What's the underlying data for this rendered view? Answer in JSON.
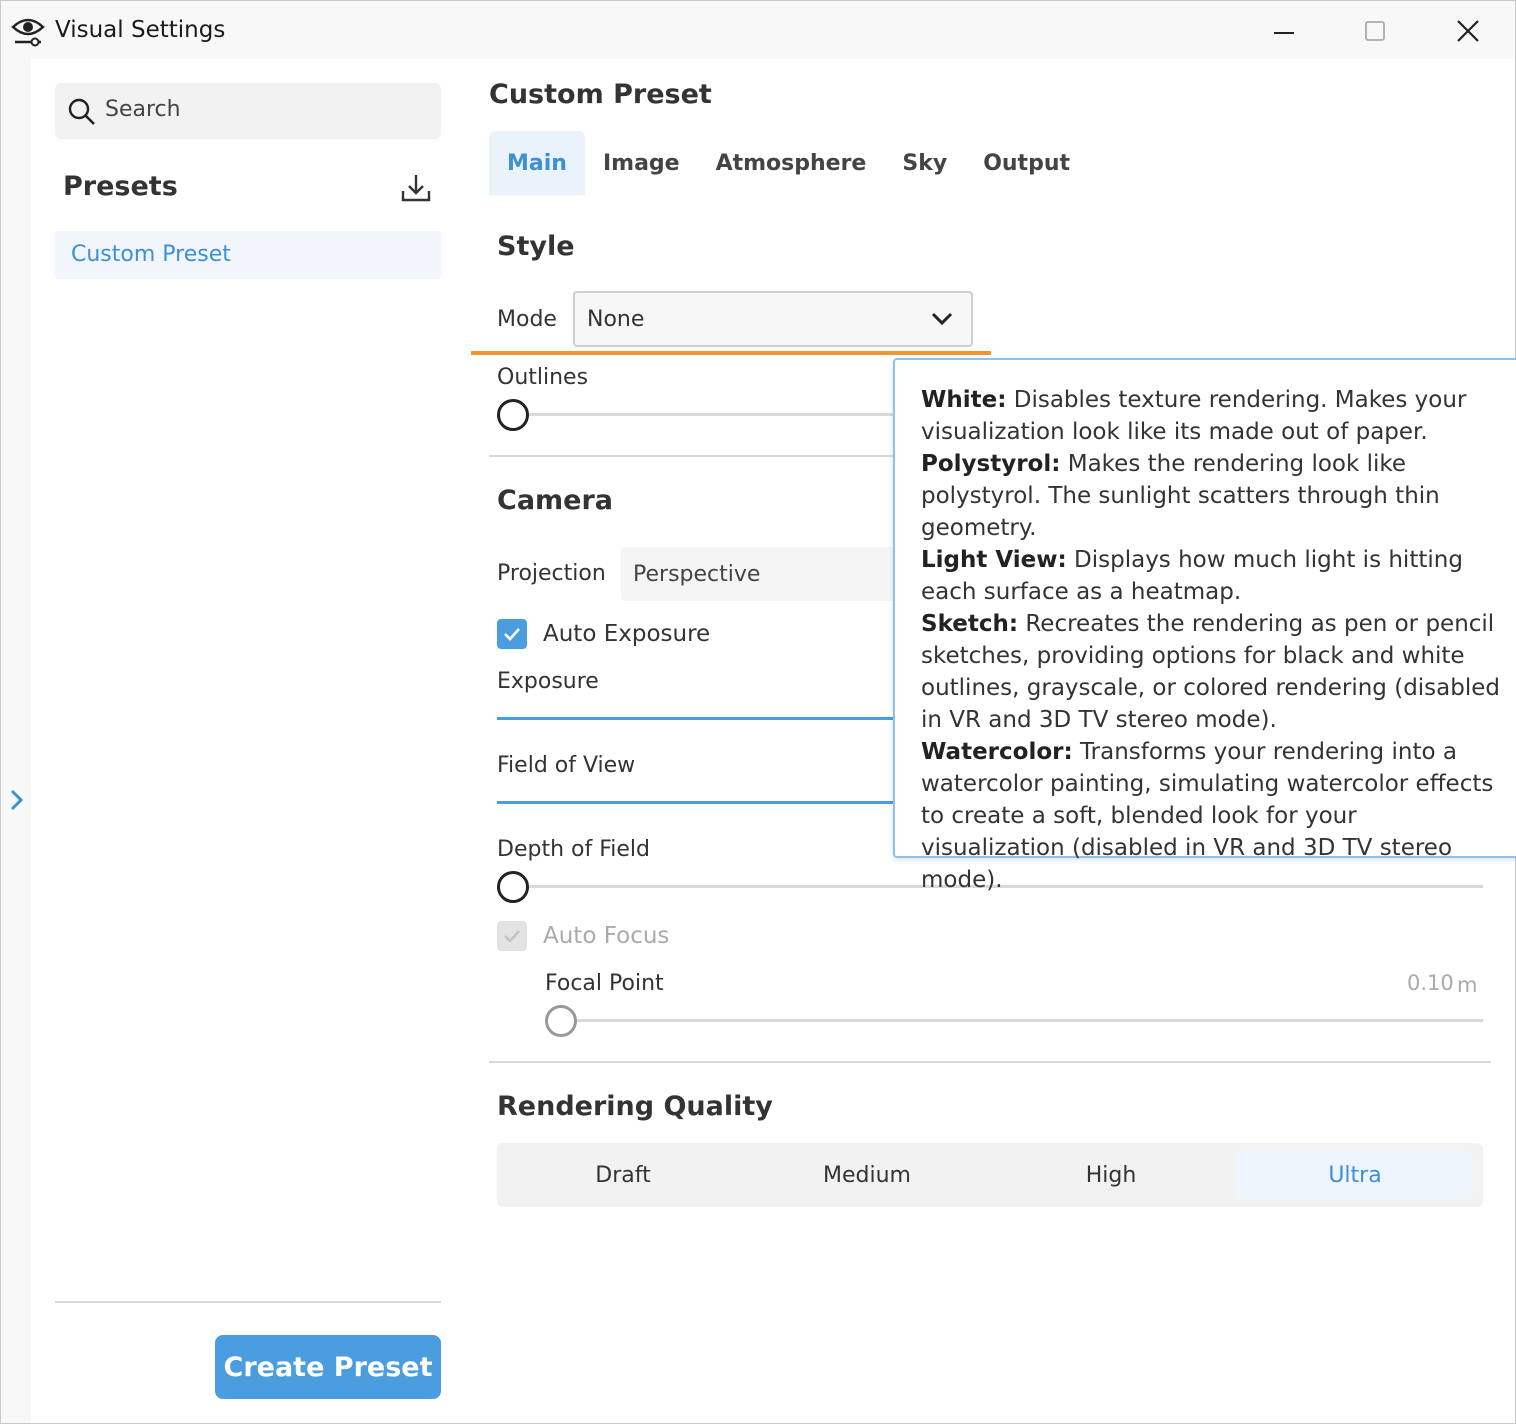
{
  "window": {
    "title": "Visual Settings"
  },
  "sidebar": {
    "search_placeholder": "Search",
    "presets_title": "Presets",
    "items": [
      {
        "label": "Custom Preset",
        "selected": true
      }
    ],
    "create_button": "Create Preset"
  },
  "main": {
    "title": "Custom Preset",
    "tabs": [
      {
        "label": "Main",
        "active": true
      },
      {
        "label": "Image"
      },
      {
        "label": "Atmosphere"
      },
      {
        "label": "Sky"
      },
      {
        "label": "Output"
      }
    ],
    "style": {
      "title": "Style",
      "mode_label": "Mode",
      "mode_value": "None",
      "outlines_label": "Outlines",
      "outlines_value": 0
    },
    "camera": {
      "title": "Camera",
      "projection_label": "Projection",
      "projection_value": "Perspective",
      "auto_exposure_label": "Auto Exposure",
      "auto_exposure_checked": true,
      "exposure_label": "Exposure",
      "fov_label": "Field of View",
      "dof_label": "Depth of Field",
      "dof_value": 0,
      "auto_focus_label": "Auto Focus",
      "auto_focus_checked": true,
      "auto_focus_disabled": true,
      "focal_point_label": "Focal Point",
      "focal_point_value": "0.10",
      "focal_point_unit": "m"
    },
    "quality": {
      "title": "Rendering Quality",
      "options": [
        "Draft",
        "Medium",
        "High",
        "Ultra"
      ],
      "selected": "Ultra"
    }
  },
  "tooltip": {
    "entries": [
      {
        "term": "White:",
        "text": " Disables texture rendering. Makes your visualization look like its made out of paper."
      },
      {
        "term": "Polystyrol:",
        "text": " Makes the rendering look like polystyrol. The sunlight scatters through thin geometry."
      },
      {
        "term": "Light View:",
        "text": " Displays how much light is hitting each surface as a heatmap."
      },
      {
        "term": "Sketch:",
        "text": " Recreates the rendering as pen or pencil sketches, providing options for black and white outlines, grayscale, or colored rendering (disabled in VR and 3D TV stereo mode)."
      },
      {
        "term": "Watercolor:",
        "text": " Transforms your rendering into a watercolor painting, simulating watercolor effects to create a soft, blended look for your visualization (disabled in VR and 3D TV stereo mode)."
      }
    ]
  },
  "colors": {
    "accent": "#4a9ee0",
    "highlight": "#f0962e",
    "tooltip_border": "#8fc2ea"
  },
  "icons": {
    "app": "eye-icon",
    "search": "search-icon",
    "import": "download-icon",
    "expand": "chevron-right-icon",
    "select": "chevron-down-icon"
  }
}
